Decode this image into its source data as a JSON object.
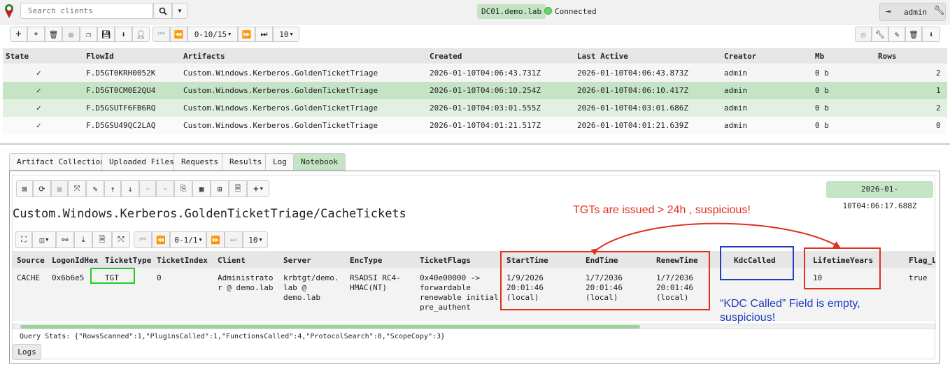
{
  "topbar": {
    "search_placeholder": "Search clients",
    "hostname": "DC01.demo.lab",
    "status": "Connected",
    "user": "admin"
  },
  "flow_toolbar": {
    "pager": "0-10/15",
    "page_size": "10"
  },
  "flows": {
    "headers": [
      "State",
      "FlowId",
      "Artifacts",
      "Created",
      "Last Active",
      "Creator",
      "Mb",
      "Rows"
    ],
    "rows": [
      {
        "state": "✓",
        "flow_id": "F.D5GT0KRH0052K",
        "artifact": "Custom.Windows.Kerberos.GoldenTicketTriage",
        "created": "2026-01-10T04:06:43.731Z",
        "last_active": "2026-01-10T04:06:43.873Z",
        "creator": "admin",
        "mb": "0 b",
        "rows": "2"
      },
      {
        "state": "✓",
        "flow_id": "F.D5GT0CM0E2QU4",
        "artifact": "Custom.Windows.Kerberos.GoldenTicketTriage",
        "created": "2026-01-10T04:06:10.254Z",
        "last_active": "2026-01-10T04:06:10.417Z",
        "creator": "admin",
        "mb": "0 b",
        "rows": "1"
      },
      {
        "state": "✓",
        "flow_id": "F.D5GSUTF6FB6RQ",
        "artifact": "Custom.Windows.Kerberos.GoldenTicketTriage",
        "created": "2026-01-10T04:03:01.555Z",
        "last_active": "2026-01-10T04:03:01.686Z",
        "creator": "admin",
        "mb": "0 b",
        "rows": "2"
      },
      {
        "state": "✓",
        "flow_id": "F.D5GSU49QC2LAQ",
        "artifact": "Custom.Windows.Kerberos.GoldenTicketTriage",
        "created": "2026-01-10T04:01:21.517Z",
        "last_active": "2026-01-10T04:01:21.639Z",
        "creator": "admin",
        "mb": "0 b",
        "rows": "0"
      }
    ]
  },
  "tabs": [
    "Artifact Collection",
    "Uploaded Files",
    "Requests",
    "Results",
    "Log",
    "Notebook"
  ],
  "notebook": {
    "timestamp": "2026-01-10T04:06:17.688Z",
    "title": "Custom.Windows.Kerberos.GoldenTicketTriage/CacheTickets",
    "pager": "0-1/1",
    "page_size": "10",
    "headers": [
      "Source",
      "LogonIdHex",
      "TicketType",
      "TicketIndex",
      "Client",
      "Server",
      "EncType",
      "TicketFlags",
      "StartTime",
      "EndTime",
      "RenewTime",
      "KdcCalled",
      "LifetimeYears",
      "Flag_Lo"
    ],
    "row": {
      "source": "CACHE",
      "logon_id_hex": "0x6b6e5",
      "ticket_type": "TGT",
      "ticket_index": "0",
      "client": [
        "Administrato",
        "r @ demo.lab"
      ],
      "server": [
        "krbtgt/demo.",
        "lab @",
        "demo.lab"
      ],
      "enc_type": [
        "RSADSI RC4-",
        "HMAC(NT)"
      ],
      "ticket_flags": [
        "0x40e00000 ->",
        "forwardable",
        "renewable initial",
        "pre_authent"
      ],
      "start_time": [
        "1/9/2026",
        "20:01:46",
        "(local)"
      ],
      "end_time": [
        "1/7/2036",
        "20:01:46",
        "(local)"
      ],
      "renew_time": [
        "1/7/2036",
        "20:01:46",
        "(local)"
      ],
      "kdc_called": "",
      "lifetime_years": "10",
      "flag_lo": "true"
    },
    "query_stats": "Query Stats: {\"RowsScanned\":1,\"PluginsCalled\":1,\"FunctionsCalled\":4,\"ProtocolSearch\":0,\"ScopeCopy\":3}",
    "logs_button": "Logs"
  },
  "annotations": {
    "tgt_note": "TGTs are issued > 24h , suspicious!",
    "kdc_note_1": "“KDC Called” Field is empty,",
    "kdc_note_2": "suspicious!"
  },
  "colors": {
    "selected_row": "#c5e3c5",
    "alt_row": "#e2f0e2",
    "annotation_red": "#e0301e",
    "annotation_blue": "#1f3fc2",
    "annotation_green": "#22cc22"
  }
}
